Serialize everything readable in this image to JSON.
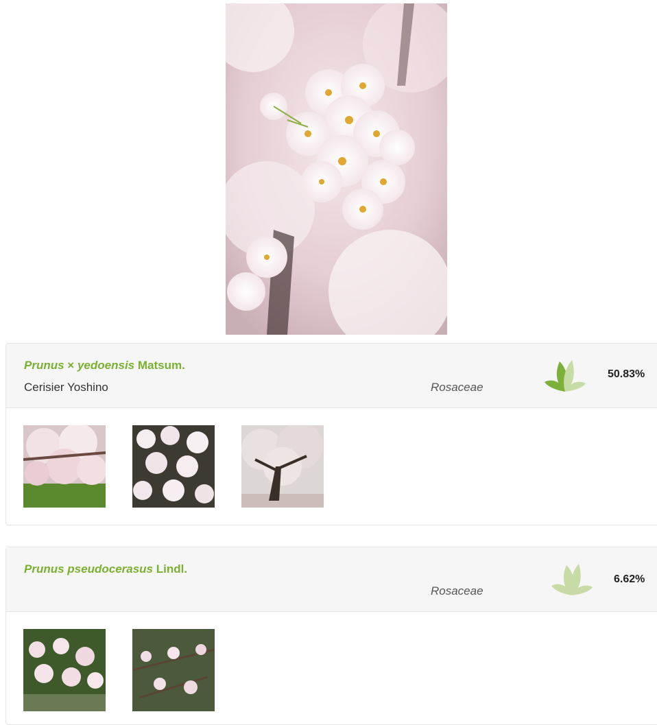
{
  "results": [
    {
      "genus": "Prunus",
      "hybrid_sign": "×",
      "species": "yedoensis",
      "author": "Matsum.",
      "common_name": "Cerisier Yoshino",
      "family": "Rosaceae",
      "score": "50.83%",
      "score_fraction": 0.5083,
      "thumb_count": 3
    },
    {
      "genus": "Prunus",
      "hybrid_sign": "",
      "species": "pseudocerasus",
      "author": "Lindl.",
      "common_name": "",
      "family": "Rosaceae",
      "score": "6.62%",
      "score_fraction": 0.0662,
      "thumb_count": 2
    }
  ],
  "colors": {
    "accent_green": "#7ab030",
    "leaf_strong": "#7cb03a",
    "leaf_light": "#c7dba4"
  },
  "icons": [
    "leaf-score-icon"
  ]
}
